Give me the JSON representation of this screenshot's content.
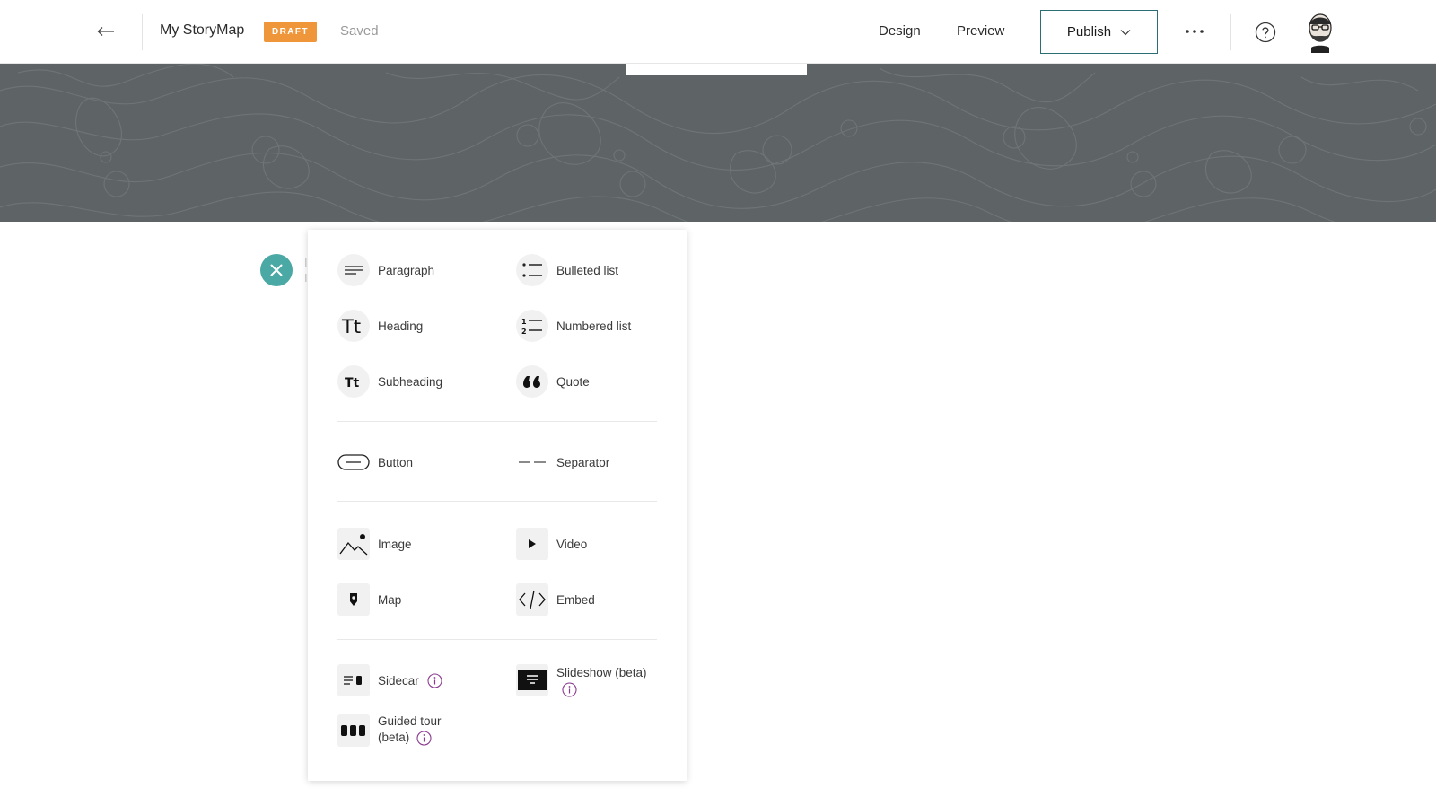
{
  "header": {
    "title": "My StoryMap",
    "badge": "DRAFT",
    "status": "Saved",
    "nav": {
      "design": "Design",
      "preview": "Preview",
      "publish": "Publish"
    }
  },
  "editor": {
    "ghost_text": "I I"
  },
  "blocks": {
    "text": [
      {
        "label": "Paragraph",
        "icon": "paragraph-icon"
      },
      {
        "label": "Bulleted list",
        "icon": "bulleted-list-icon"
      },
      {
        "label": "Heading",
        "icon": "heading-icon"
      },
      {
        "label": "Numbered list",
        "icon": "numbered-list-icon"
      },
      {
        "label": "Subheading",
        "icon": "subheading-icon"
      },
      {
        "label": "Quote",
        "icon": "quote-icon"
      }
    ],
    "misc": [
      {
        "label": "Button",
        "icon": "button-icon"
      },
      {
        "label": "Separator",
        "icon": "separator-icon"
      }
    ],
    "media": [
      {
        "label": "Image",
        "icon": "image-icon"
      },
      {
        "label": "Video",
        "icon": "video-icon"
      },
      {
        "label": "Map",
        "icon": "map-icon"
      },
      {
        "label": "Embed",
        "icon": "embed-icon"
      }
    ],
    "immersive": [
      {
        "label": "Sidecar",
        "icon": "sidecar-icon"
      },
      {
        "label": "Slideshow (beta)",
        "icon": "slideshow-icon"
      },
      {
        "label_line1": "Guided tour",
        "label_line2": "(beta)",
        "icon": "guided-tour-icon"
      }
    ]
  },
  "colors": {
    "accent": "#4aa8a5",
    "draft_badge": "#f0963a",
    "publish_border": "#2b6e74",
    "hero": "#5e6466",
    "info": "#8a3a8f"
  }
}
